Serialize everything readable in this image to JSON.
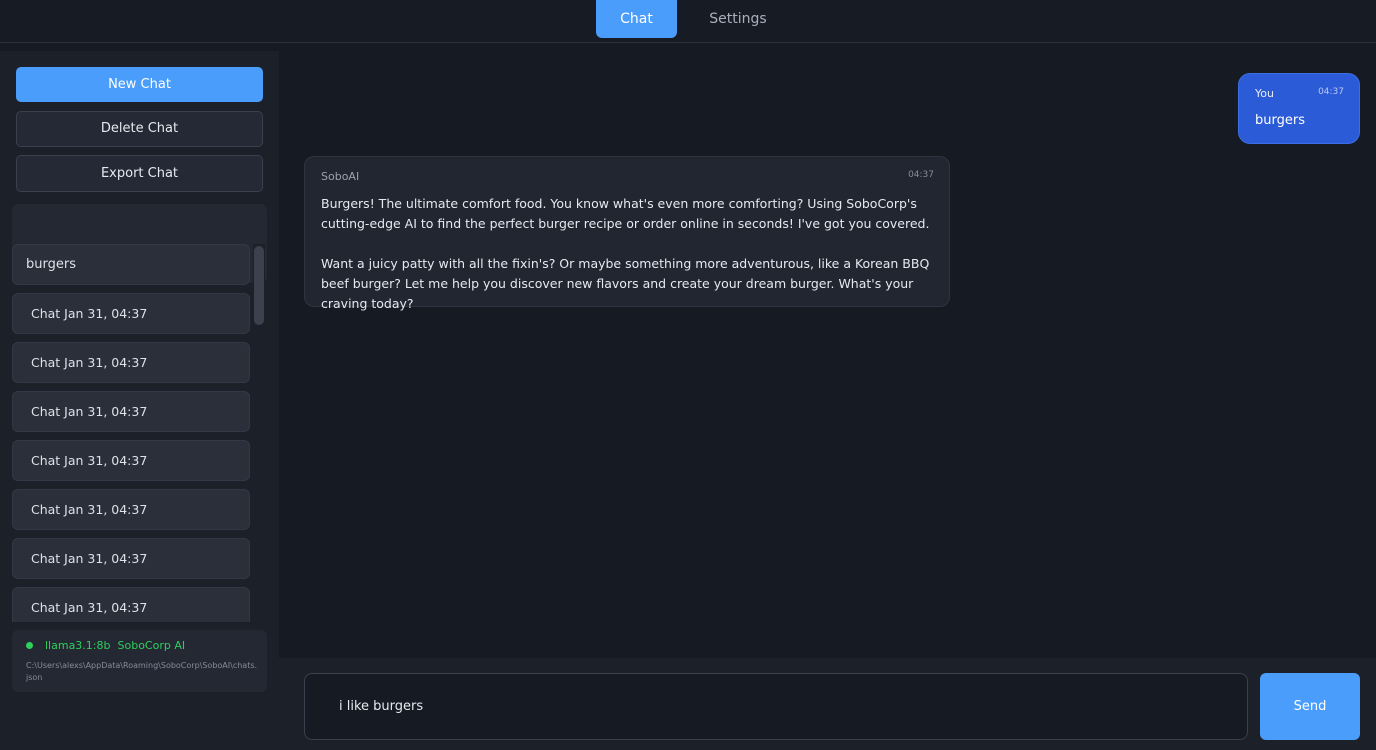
{
  "tabs": [
    {
      "label": "Chat",
      "active": true
    },
    {
      "label": "Settings",
      "active": false
    }
  ],
  "sidebar": {
    "new_chat_label": "New Chat",
    "delete_chat_label": "Delete Chat",
    "export_chat_label": "Export Chat",
    "chats": [
      "burgers",
      "Chat Jan 31, 04:37",
      "Chat Jan 31, 04:37",
      "Chat Jan 31, 04:37",
      "Chat Jan 31, 04:37",
      "Chat Jan 31, 04:37",
      "Chat Jan 31, 04:37",
      "Chat Jan 31, 04:37"
    ],
    "status": {
      "model": "llama3.1:8b",
      "provider": "SoboCorp AI",
      "path": "C:\\Users\\alexs\\AppData\\Roaming\\SoboCorp\\SoboAI\\chats.json"
    }
  },
  "messages": [
    {
      "sender": "You",
      "time": "04:37",
      "text": "burgers"
    },
    {
      "sender": "SoboAI",
      "time": "04:37",
      "text": "Burgers! The ultimate comfort food. You know what's even more comforting? Using SoboCorp's cutting-edge AI to find the perfect burger recipe or order online in seconds! I've got you covered.\n\nWant a juicy patty with all the fixin's? Or maybe something more adventurous, like a Korean BBQ beef burger? Let me help you discover new flavors and create your dream burger. What's your craving today?"
    }
  ],
  "composer": {
    "value": "i like burgers",
    "send_label": "Send"
  },
  "colors": {
    "accent": "#4a9dfb",
    "user_bubble": "#2b5bd6",
    "status_green": "#2fcf5c"
  }
}
